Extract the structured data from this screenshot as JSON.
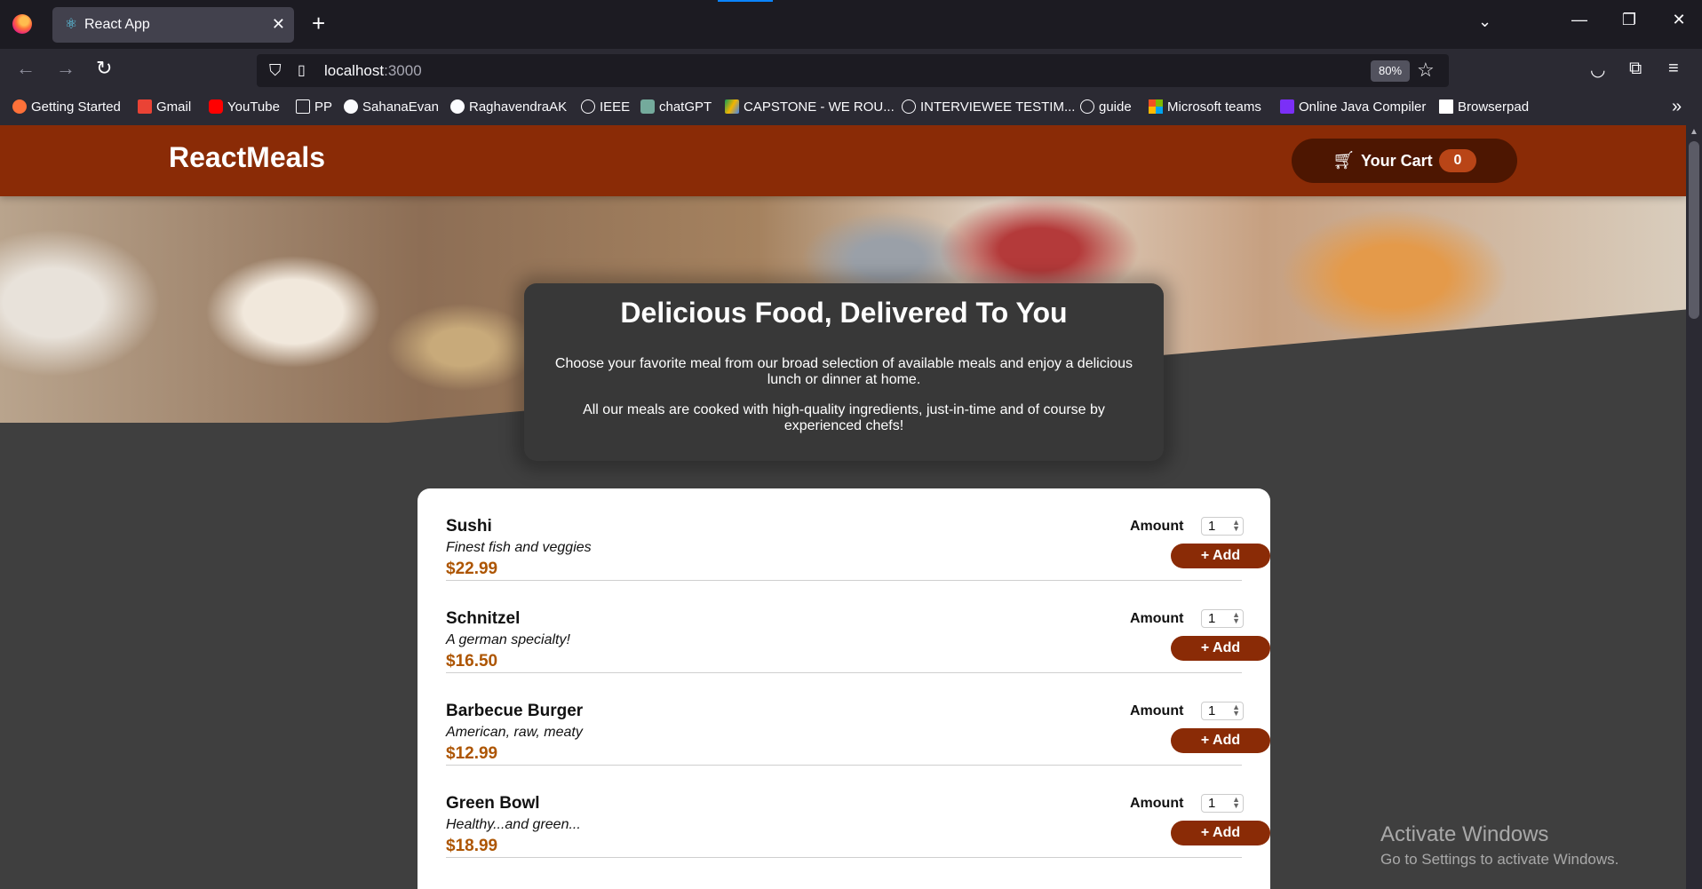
{
  "browser": {
    "tab_title": "React App",
    "url_host": "localhost",
    "url_port": ":3000",
    "zoom": "80%",
    "bookmarks": [
      {
        "label": "Getting Started",
        "color": "#ff7139"
      },
      {
        "label": "Gmail",
        "color": "#ea4335"
      },
      {
        "label": "YouTube",
        "color": "#ff0000"
      },
      {
        "label": "PP",
        "color": "#fbfbfe"
      },
      {
        "label": "SahanaEvan",
        "color": "#fbfbfe"
      },
      {
        "label": "RaghavendraAK",
        "color": "#fbfbfe"
      },
      {
        "label": "IEEE",
        "color": "#fbfbfe"
      },
      {
        "label": "chatGPT",
        "color": "#74aa9c"
      },
      {
        "label": "CAPSTONE - WE ROU...",
        "color": "#f4b400"
      },
      {
        "label": "INTERVIEWEE TESTIM...",
        "color": "#fbfbfe"
      },
      {
        "label": "guide",
        "color": "#fbfbfe"
      },
      {
        "label": "Microsoft teams",
        "color": "#7fba00"
      },
      {
        "label": "Online Java Compiler",
        "color": "#7b2ff7"
      },
      {
        "label": "Browserpad",
        "color": "#ffffff"
      }
    ]
  },
  "app": {
    "brand": "ReactMeals",
    "cart_label": "Your Cart",
    "cart_count": "0",
    "accent": "#8a2b06"
  },
  "summary": {
    "title": "Delicious Food, Delivered To You",
    "p1": "Choose your favorite meal from our broad selection of available meals and enjoy a delicious lunch or dinner at home.",
    "p2": "All our meals are cooked with high-quality ingredients, just-in-time and of course by experienced chefs!"
  },
  "meals": [
    {
      "name": "Sushi",
      "description": "Finest fish and veggies",
      "price": "$22.99",
      "amount_label": "Amount",
      "amount": "1",
      "add_label": "+ Add"
    },
    {
      "name": "Schnitzel",
      "description": "A german specialty!",
      "price": "$16.50",
      "amount_label": "Amount",
      "amount": "1",
      "add_label": "+ Add"
    },
    {
      "name": "Barbecue Burger",
      "description": "American, raw, meaty",
      "price": "$12.99",
      "amount_label": "Amount",
      "amount": "1",
      "add_label": "+ Add"
    },
    {
      "name": "Green Bowl",
      "description": "Healthy...and green...",
      "price": "$18.99",
      "amount_label": "Amount",
      "amount": "1",
      "add_label": "+ Add"
    }
  ],
  "watermark": {
    "title": "Activate Windows",
    "subtitle": "Go to Settings to activate Windows."
  }
}
